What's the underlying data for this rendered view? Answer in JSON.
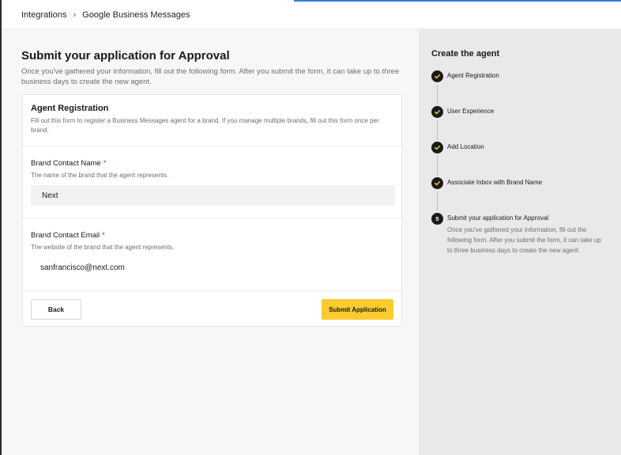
{
  "breadcrumb": {
    "items": [
      "Integrations",
      "Google Business Messages"
    ],
    "separator": "›"
  },
  "page": {
    "title": "Submit your application for Approval",
    "description": "Once you've gathered your information, fill out the following form. After you submit the form, it can take up to three business days to create the new agent."
  },
  "form": {
    "title": "Agent Registration",
    "description": "Fill out this form to register a Business Messages agent for a brand. If you manage multiple brands, fill out this form once per brand.",
    "brand_contact_name": {
      "label": "Brand Contact Name",
      "required_mark": "*",
      "help": "The name of the brand that the agent represents.",
      "value": "Next"
    },
    "brand_contact_email": {
      "label": "Brand Contact Email",
      "required_mark": "*",
      "help": "The website of the brand that the agent represents.",
      "value": "sanfrancisco@next.com"
    },
    "back_label": "Back",
    "submit_label": "Submit Application"
  },
  "sidebar": {
    "title": "Create the agent",
    "steps": [
      {
        "label": "Agent Registration",
        "status": "done"
      },
      {
        "label": "User Experience",
        "status": "done"
      },
      {
        "label": "Add Location",
        "status": "done"
      },
      {
        "label": "Associate Inbox with Brand Name",
        "status": "done"
      },
      {
        "label": "Submit your application for Approval",
        "status": "current",
        "number": "5",
        "description": "Once you've gathered your information, fill out the following form. After you submit the form, it can take up to three business days to create the new agent."
      }
    ]
  },
  "colors": {
    "accent": "#fdcb2e",
    "required": "#d02a2a",
    "step_circle": "#1a1a1a",
    "sidebar_bg": "#e9e9e9",
    "main_bg": "#f7f7f7"
  }
}
